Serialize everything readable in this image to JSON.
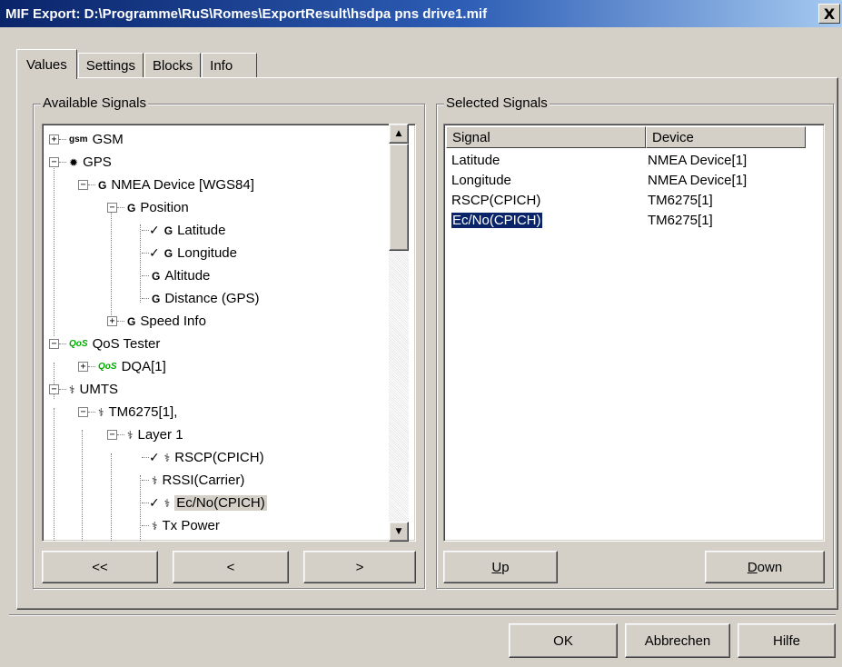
{
  "window": {
    "title": "MIF Export: D:\\Programme\\RuS\\Romes\\ExportResult\\hsdpa pns drive1.mif",
    "close_label": "X"
  },
  "tabs": [
    {
      "label": "Values",
      "active": true
    },
    {
      "label": "Settings",
      "active": false
    },
    {
      "label": "Blocks",
      "active": false
    },
    {
      "label": "Info",
      "active": false
    }
  ],
  "available": {
    "title": "Available Signals",
    "tree": [
      {
        "label": "GSM",
        "icon": "gsm",
        "expander": "+"
      },
      {
        "label": "GPS",
        "icon": "gps",
        "expander": "-"
      },
      {
        "label": "NMEA Device [WGS84]",
        "icon": "gps-device",
        "expander": "-"
      },
      {
        "label": "Position",
        "icon": "gps-device",
        "expander": "-"
      },
      {
        "label": "Latitude",
        "icon": "gps-device",
        "checked": true
      },
      {
        "label": "Longitude",
        "icon": "gps-device",
        "checked": true
      },
      {
        "label": "Altitude",
        "icon": "gps-device"
      },
      {
        "label": "Distance (GPS)",
        "icon": "gps-device"
      },
      {
        "label": "Speed Info",
        "icon": "gps-device",
        "expander": "+"
      },
      {
        "label": "QoS Tester",
        "icon": "qos",
        "expander": "-"
      },
      {
        "label": "DQA[1]",
        "icon": "qos",
        "expander": "+"
      },
      {
        "label": "UMTS",
        "icon": "umts",
        "expander": "-"
      },
      {
        "label": "TM6275[1],",
        "icon": "umts",
        "expander": "-"
      },
      {
        "label": "Layer 1",
        "icon": "umts",
        "expander": "-"
      },
      {
        "label": "RSCP(CPICH)",
        "icon": "umts",
        "checked": true
      },
      {
        "label": "RSSI(Carrier)",
        "icon": "umts"
      },
      {
        "label": "Ec/No(CPICH)",
        "icon": "umts",
        "checked": true,
        "highlighted": true
      },
      {
        "label": "Tx Power",
        "icon": "umts"
      }
    ],
    "icon_text": {
      "gsm": "gsm",
      "qos": "QoS",
      "gps": "✹",
      "gps-device": "G",
      "umts": "⚕"
    },
    "buttons": {
      "all_left": "<<",
      "left": "<",
      "right": ">"
    }
  },
  "selected": {
    "title": "Selected Signals",
    "columns": [
      "Signal",
      "Device"
    ],
    "rows": [
      {
        "signal": "Latitude",
        "device": "NMEA Device[1]"
      },
      {
        "signal": "Longitude",
        "device": "NMEA Device[1]"
      },
      {
        "signal": "RSCP(CPICH)",
        "device": "TM6275[1]"
      },
      {
        "signal": "Ec/No(CPICH)",
        "device": "TM6275[1]",
        "selected": true
      }
    ],
    "buttons": {
      "up": "Up",
      "down": "Down"
    }
  },
  "footer": {
    "ok": "OK",
    "cancel": "Abbrechen",
    "help": "Hilfe"
  }
}
